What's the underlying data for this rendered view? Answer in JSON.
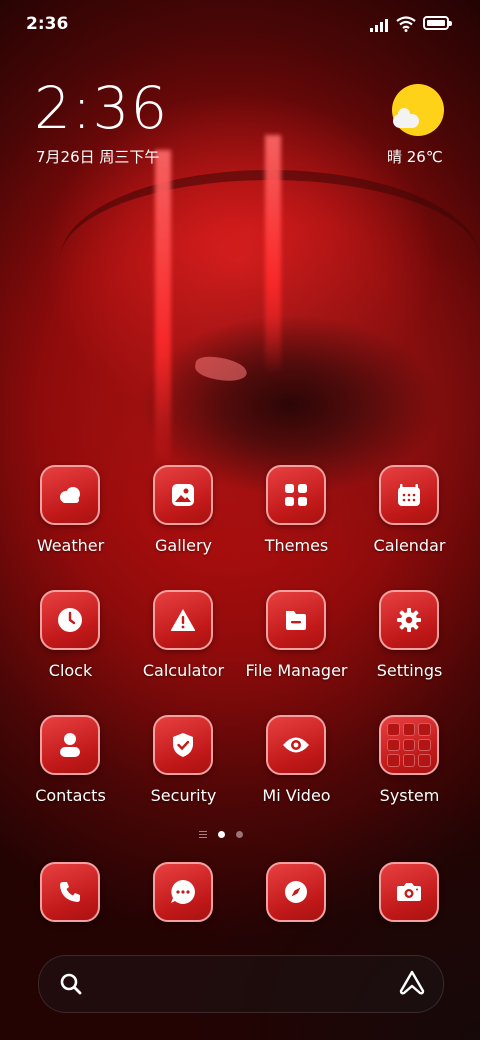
{
  "status_bar": {
    "time": "2:36"
  },
  "clock_widget": {
    "time": "2:36",
    "date": "7月26日 周三下午"
  },
  "weather_widget": {
    "text": "晴 26℃"
  },
  "apps": [
    {
      "label": "Weather",
      "icon": "weather-icon"
    },
    {
      "label": "Gallery",
      "icon": "gallery-icon"
    },
    {
      "label": "Themes",
      "icon": "themes-icon"
    },
    {
      "label": "Calendar",
      "icon": "calendar-icon"
    },
    {
      "label": "Clock",
      "icon": "clock-icon"
    },
    {
      "label": "Calculator",
      "icon": "alert-icon"
    },
    {
      "label": "File Manager",
      "icon": "folder-icon"
    },
    {
      "label": "Settings",
      "icon": "gear-icon"
    },
    {
      "label": "Contacts",
      "icon": "person-icon"
    },
    {
      "label": "Security",
      "icon": "shield-icon"
    },
    {
      "label": "Mi Video",
      "icon": "eye-icon"
    },
    {
      "label": "System",
      "icon": "folder-grid-icon"
    }
  ],
  "dock": [
    {
      "icon": "phone-icon"
    },
    {
      "icon": "message-icon"
    },
    {
      "icon": "compass-icon"
    },
    {
      "icon": "camera-icon"
    }
  ],
  "pager": {
    "pages": 2,
    "current": 1
  },
  "search_bar": {
    "icons": [
      "search-icon",
      "assistant-icon"
    ]
  },
  "colors": {
    "accent": "#d12a2a",
    "icon_border": "#f3a0a0",
    "sun": "#ffd21a"
  }
}
